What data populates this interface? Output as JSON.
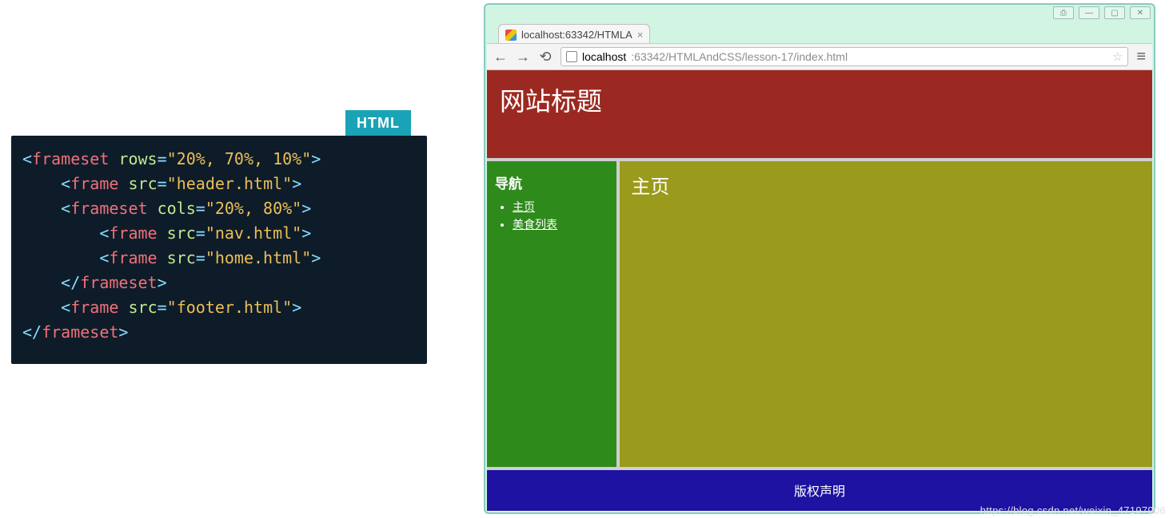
{
  "code": {
    "badge": "HTML",
    "lines": [
      [
        {
          "cls": "tok-punct",
          "t": "<"
        },
        {
          "cls": "tok-tag",
          "t": "frameset"
        },
        {
          "cls": "",
          "t": " "
        },
        {
          "cls": "tok-attr",
          "t": "rows"
        },
        {
          "cls": "tok-punct",
          "t": "="
        },
        {
          "cls": "tok-str",
          "t": "\"20%, 70%, 10%\""
        },
        {
          "cls": "tok-punct",
          "t": ">"
        }
      ],
      [
        {
          "cls": "",
          "t": "    "
        },
        {
          "cls": "tok-punct",
          "t": "<"
        },
        {
          "cls": "tok-tag",
          "t": "frame"
        },
        {
          "cls": "",
          "t": " "
        },
        {
          "cls": "tok-attr",
          "t": "src"
        },
        {
          "cls": "tok-punct",
          "t": "="
        },
        {
          "cls": "tok-str",
          "t": "\"header.html\""
        },
        {
          "cls": "tok-punct",
          "t": ">"
        }
      ],
      [
        {
          "cls": "",
          "t": "    "
        },
        {
          "cls": "tok-punct",
          "t": "<"
        },
        {
          "cls": "tok-tag",
          "t": "frameset"
        },
        {
          "cls": "",
          "t": " "
        },
        {
          "cls": "tok-attr",
          "t": "cols"
        },
        {
          "cls": "tok-punct",
          "t": "="
        },
        {
          "cls": "tok-str",
          "t": "\"20%, 80%\""
        },
        {
          "cls": "tok-punct",
          "t": ">"
        }
      ],
      [
        {
          "cls": "",
          "t": "        "
        },
        {
          "cls": "tok-punct",
          "t": "<"
        },
        {
          "cls": "tok-tag",
          "t": "frame"
        },
        {
          "cls": "",
          "t": " "
        },
        {
          "cls": "tok-attr",
          "t": "src"
        },
        {
          "cls": "tok-punct",
          "t": "="
        },
        {
          "cls": "tok-str",
          "t": "\"nav.html\""
        },
        {
          "cls": "tok-punct",
          "t": ">"
        }
      ],
      [
        {
          "cls": "",
          "t": "        "
        },
        {
          "cls": "tok-punct",
          "t": "<"
        },
        {
          "cls": "tok-tag",
          "t": "frame"
        },
        {
          "cls": "",
          "t": " "
        },
        {
          "cls": "tok-attr",
          "t": "src"
        },
        {
          "cls": "tok-punct",
          "t": "="
        },
        {
          "cls": "tok-str",
          "t": "\"home.html\""
        },
        {
          "cls": "tok-punct",
          "t": ">"
        }
      ],
      [
        {
          "cls": "",
          "t": "    "
        },
        {
          "cls": "tok-punct",
          "t": "</"
        },
        {
          "cls": "tok-tag",
          "t": "frameset"
        },
        {
          "cls": "tok-punct",
          "t": ">"
        }
      ],
      [
        {
          "cls": "",
          "t": "    "
        },
        {
          "cls": "tok-punct",
          "t": "<"
        },
        {
          "cls": "tok-tag",
          "t": "frame"
        },
        {
          "cls": "",
          "t": " "
        },
        {
          "cls": "tok-attr",
          "t": "src"
        },
        {
          "cls": "tok-punct",
          "t": "="
        },
        {
          "cls": "tok-str",
          "t": "\"footer.html\""
        },
        {
          "cls": "tok-punct",
          "t": ">"
        }
      ],
      [
        {
          "cls": "tok-punct",
          "t": "</"
        },
        {
          "cls": "tok-tag",
          "t": "frameset"
        },
        {
          "cls": "tok-punct",
          "t": ">"
        }
      ]
    ]
  },
  "browser": {
    "window_buttons": [
      "print-icon",
      "minimize-icon",
      "maximize-icon",
      "close-icon"
    ],
    "tab": {
      "title": "localhost:63342/HTMLA"
    },
    "url": {
      "host": "localhost",
      "path": ":63342/HTMLAndCSS/lesson-17/index.html"
    }
  },
  "page": {
    "header_title": "网站标题",
    "nav": {
      "heading": "导航",
      "links": [
        "主页",
        "美食列表"
      ]
    },
    "home_title": "主页",
    "footer_text": "版权声明"
  },
  "watermark": "https://blog.csdn.net/weixin_47197906"
}
